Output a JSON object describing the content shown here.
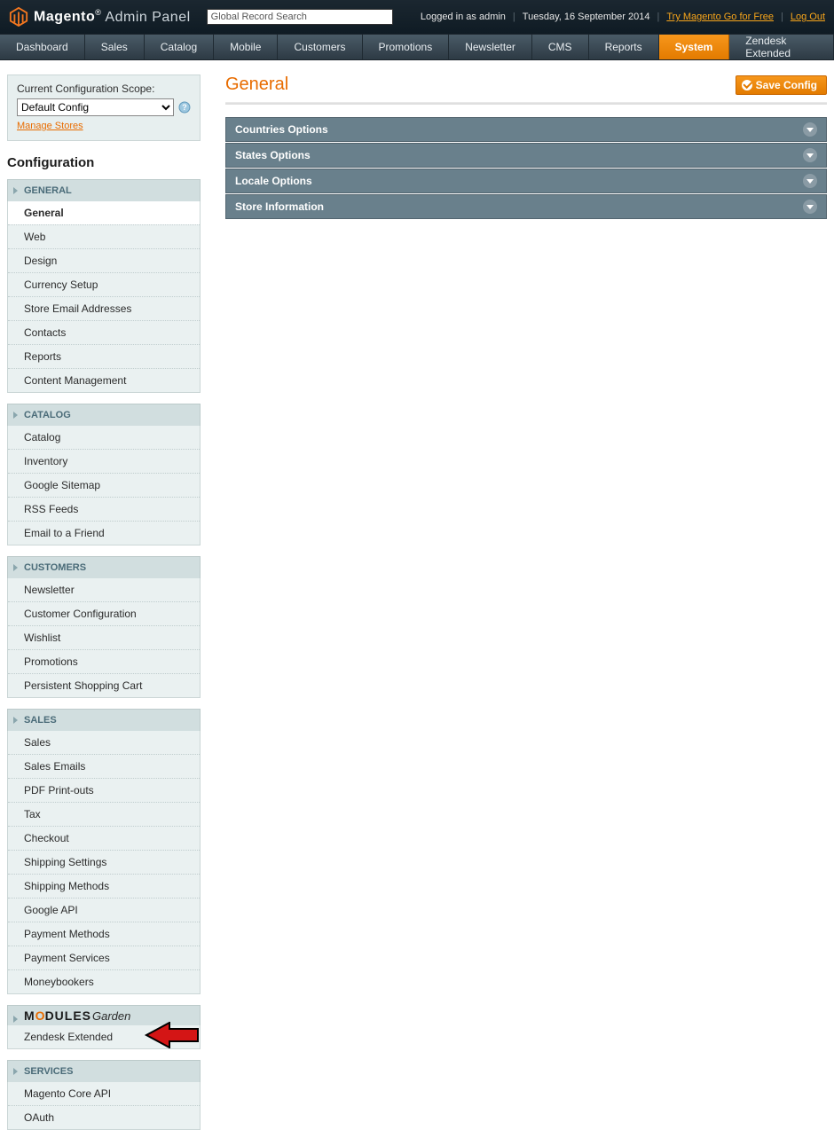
{
  "header": {
    "brand_bold": "Magento",
    "brand_tm": "®",
    "brand_admin": "Admin Panel",
    "search_value": "Global Record Search",
    "logged": "Logged in as admin",
    "date": "Tuesday, 16 September 2014",
    "try_link": "Try Magento Go for Free",
    "logout": "Log Out"
  },
  "nav": {
    "items": [
      "Dashboard",
      "Sales",
      "Catalog",
      "Mobile",
      "Customers",
      "Promotions",
      "Newsletter",
      "CMS",
      "Reports",
      "System",
      "Zendesk Extended"
    ],
    "active_index": 9
  },
  "scope": {
    "label": "Current Configuration Scope:",
    "selected": "Default Config",
    "manage": "Manage Stores"
  },
  "config_heading": "Configuration",
  "sidebar": [
    {
      "title": "GENERAL",
      "items": [
        "General",
        "Web",
        "Design",
        "Currency Setup",
        "Store Email Addresses",
        "Contacts",
        "Reports",
        "Content Management"
      ],
      "active_index": 0
    },
    {
      "title": "CATALOG",
      "items": [
        "Catalog",
        "Inventory",
        "Google Sitemap",
        "RSS Feeds",
        "Email to a Friend"
      ]
    },
    {
      "title": "CUSTOMERS",
      "items": [
        "Newsletter",
        "Customer Configuration",
        "Wishlist",
        "Promotions",
        "Persistent Shopping Cart"
      ]
    },
    {
      "title": "SALES",
      "items": [
        "Sales",
        "Sales Emails",
        "PDF Print-outs",
        "Tax",
        "Checkout",
        "Shipping Settings",
        "Shipping Methods",
        "Google API",
        "Payment Methods",
        "Payment Services",
        "Moneybookers"
      ]
    },
    {
      "title_type": "modulesgarden",
      "items": [
        "Zendesk Extended"
      ],
      "arrow": true
    },
    {
      "title": "SERVICES",
      "items": [
        "Magento Core API",
        "OAuth"
      ]
    }
  ],
  "page": {
    "title": "General",
    "save": "Save Config",
    "panels": [
      "Countries Options",
      "States Options",
      "Locale Options",
      "Store Information"
    ]
  }
}
